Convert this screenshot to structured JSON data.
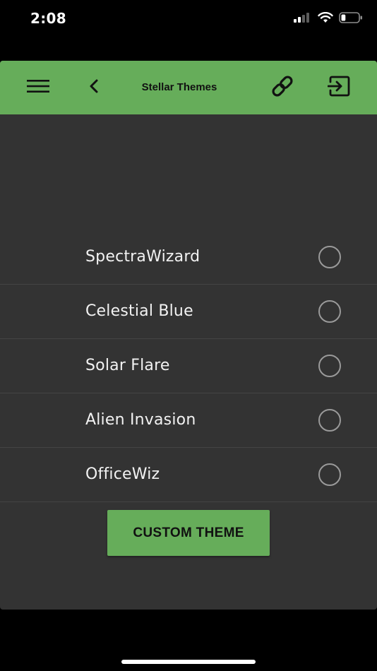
{
  "status_bar": {
    "time": "2:08",
    "icons": [
      "cellular-signal-icon",
      "wifi-icon",
      "battery-icon"
    ],
    "battery_level": 0.25
  },
  "header": {
    "title": "Stellar Themes",
    "icons": [
      "hamburger-menu-icon",
      "chevron-left-icon",
      "link-icon",
      "logout-icon"
    ]
  },
  "themes": [
    {
      "label": "SpectraWizard",
      "selected": false
    },
    {
      "label": "Celestial Blue",
      "selected": false
    },
    {
      "label": "Solar Flare",
      "selected": false
    },
    {
      "label": "Alien Invasion",
      "selected": false
    },
    {
      "label": "OfficeWiz",
      "selected": false
    }
  ],
  "custom_button": {
    "label": "CUSTOM THEME"
  },
  "colors": {
    "accent": "#66ad5a",
    "card_background": "#333333",
    "page_background": "#000000",
    "text": "#f2f2f2",
    "radio_border": "#9a9a9a"
  }
}
